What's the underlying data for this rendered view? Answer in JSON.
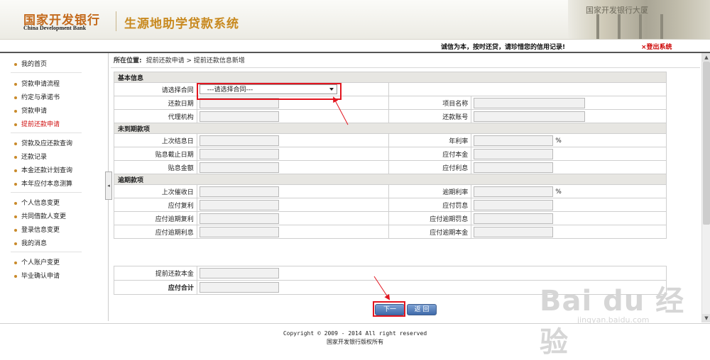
{
  "header": {
    "bank_name_cn": "国家开发银行",
    "bank_name_en": "China Development Bank",
    "system_title": "生源地助学贷款系统",
    "building_sign": "国家开发银行大厦"
  },
  "notice": {
    "text": "诚信为本，按时还贷，请珍惜您的信用记录!",
    "logout": "×登出系统"
  },
  "sidebar": {
    "items": [
      {
        "label": "我的首页"
      },
      {
        "label": "贷款申请流程"
      },
      {
        "label": "约定与承诺书"
      },
      {
        "label": "贷款申请"
      },
      {
        "label": "提前还款申请",
        "active": true
      },
      {
        "label": "贷款及应还款查询"
      },
      {
        "label": "还款记录"
      },
      {
        "label": "本金还款计划查询"
      },
      {
        "label": "本年应付本息测算"
      },
      {
        "label": "个人信息变更"
      },
      {
        "label": "共同借款人变更"
      },
      {
        "label": "登录信息变更"
      },
      {
        "label": "我的消息"
      },
      {
        "label": "个人账户变更"
      },
      {
        "label": "毕业确认申请"
      }
    ],
    "collapse_glyph": "◂"
  },
  "breadcrumb": {
    "prefix": "所在位置:",
    "path": "提前还款申请 > 提前还款信息新增"
  },
  "form": {
    "basic": {
      "title": "基本信息",
      "contract_label": "请选择合同",
      "contract_value": "---请选择合同---",
      "repay_date": "还款日期",
      "project_name": "项目名称",
      "agency": "代理机构",
      "repay_account": "还款账号"
    },
    "due": {
      "title": "未到期款项",
      "last_settle": "上次结息日",
      "annual_rate": "年利率",
      "discount_end": "贴息截止日期",
      "principal_due": "应付本金",
      "discount_amount": "贴息金额",
      "interest_due": "应付利息",
      "pct": "%"
    },
    "overdue": {
      "title": "逾期款项",
      "last_collect": "上次催收日",
      "overdue_rate": "逾期利率",
      "compound_due": "应付复利",
      "penalty_due": "应付罚息",
      "overdue_compound": "应付逾期复利",
      "overdue_penalty": "应付逾期罚息",
      "overdue_interest": "应付逾期利息",
      "overdue_principal": "应付逾期本金",
      "pct": "%"
    },
    "totals": {
      "prepay_principal": "提前还款本金",
      "total_due": "应付合计"
    }
  },
  "buttons": {
    "next": "下一步",
    "back": "返 回"
  },
  "footer": {
    "copyright": "Copyright © 2009 - 2014 All right reserved",
    "owner": "国家开发银行版权所有"
  },
  "watermark": {
    "big": "Bai du 经验",
    "small": "jingyan.baidu.com"
  },
  "scrollbar": {
    "up": "▲",
    "down": "▼"
  },
  "colors": {
    "accent_red": "#e2151f",
    "logo_orange": "#c46a1c",
    "button_blue": "#3f6aa9"
  }
}
